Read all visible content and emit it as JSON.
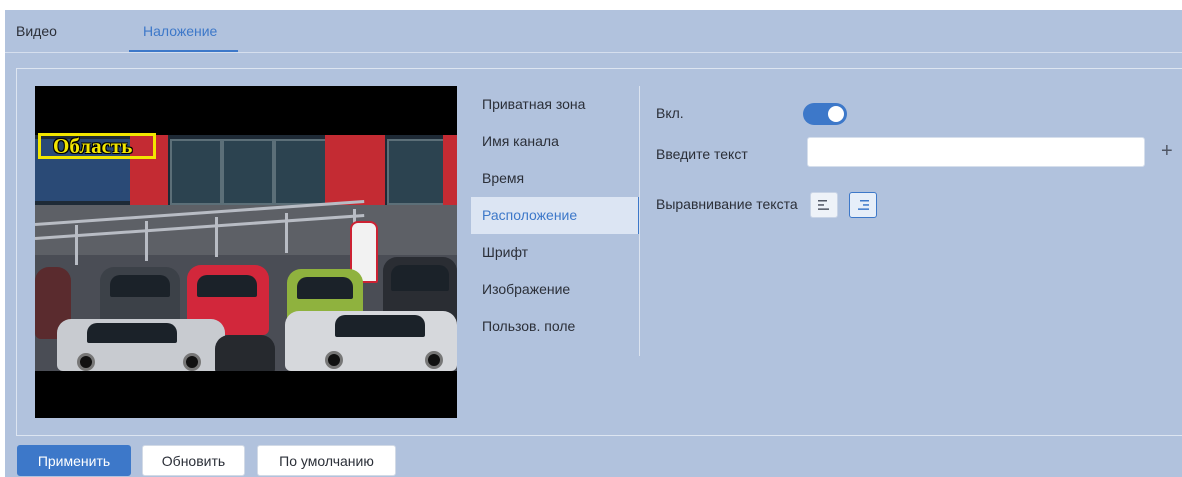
{
  "tabs": [
    {
      "label": "Видео",
      "active": false
    },
    {
      "label": "Наложение",
      "active": true
    }
  ],
  "preview": {
    "overlay_text": "Область"
  },
  "menu": {
    "items": [
      {
        "label": "Приватная зона"
      },
      {
        "label": "Имя канала"
      },
      {
        "label": "Время"
      },
      {
        "label": "Расположение",
        "active": true
      },
      {
        "label": "Шрифт"
      },
      {
        "label": "Изображение"
      },
      {
        "label": "Пользов. поле"
      }
    ]
  },
  "settings": {
    "enable_label": "Вкл.",
    "enabled": true,
    "text_label": "Введите текст",
    "text_value": "",
    "add_symbol": "+",
    "align_label": "Выравнивание текста",
    "align_options": [
      "left-align-icon",
      "right-align-icon"
    ],
    "align_selected": "right"
  },
  "buttons": {
    "apply": "Применить",
    "refresh": "Обновить",
    "default": "По умолчанию"
  },
  "colors": {
    "accent": "#3d78c9",
    "background": "#b1c2dd",
    "overlay_text": "#f2e600"
  }
}
